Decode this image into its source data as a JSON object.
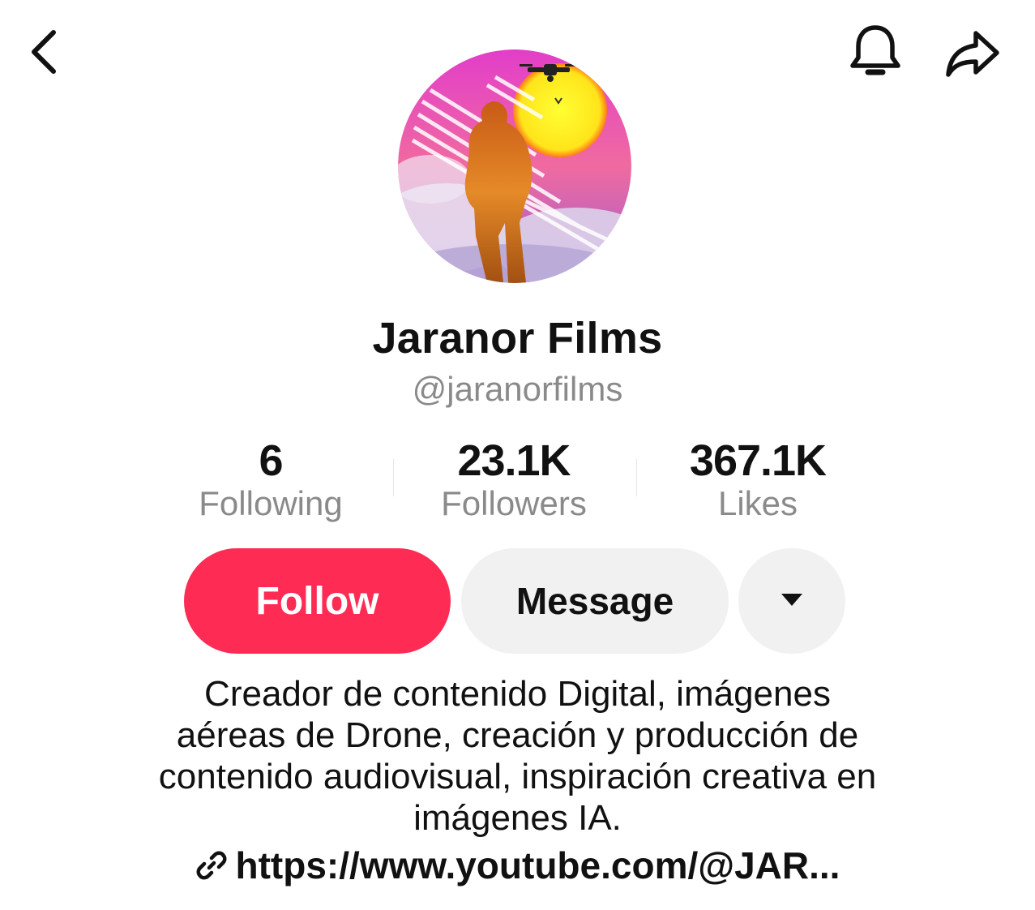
{
  "header": {
    "back_icon": "chevron-left-icon",
    "notification_icon": "bell-icon",
    "share_icon": "share-arrow-icon"
  },
  "profile": {
    "display_name": "Jaranor Films",
    "username": "@jaranorfilms",
    "avatar_description": "person-silhouette-sunset-drone-avatar"
  },
  "stats": [
    {
      "value": "6",
      "label": "Following"
    },
    {
      "value": "23.1K",
      "label": "Followers"
    },
    {
      "value": "367.1K",
      "label": "Likes"
    }
  ],
  "actions": {
    "follow_label": "Follow",
    "message_label": "Message",
    "more_icon": "caret-down-icon"
  },
  "bio": {
    "lines": [
      "Creador de contenido Digital, imágenes",
      "aéreas de Drone, creación y producción de",
      "contenido audiovisual, inspiración creativa en",
      "imágenes IA."
    ]
  },
  "link": {
    "icon": "link-icon",
    "text": "https://www.youtube.com/@JAR..."
  },
  "colors": {
    "follow_bg": "#fe2c55",
    "secondary_bg": "#f1f1f2",
    "muted_text": "#8a8a8a",
    "primary_text": "#111111"
  }
}
